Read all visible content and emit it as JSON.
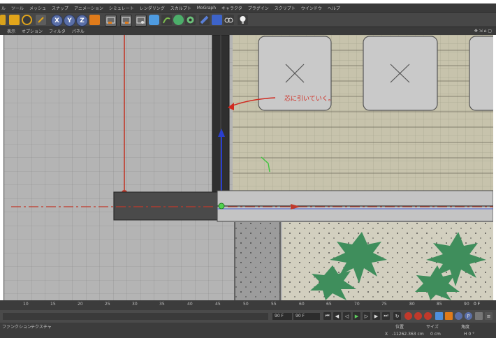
{
  "menu": {
    "items": [
      "ル",
      "ツール",
      "メッシュ",
      "スナップ",
      "アニメーション",
      "シミュレート",
      "レンダリング",
      "スカルプト",
      "MoGraph",
      "キャラクタ",
      "プラグイン",
      "スクリプト",
      "ウインドウ",
      "ヘルプ"
    ]
  },
  "toolbar": {
    "axis_x": "X",
    "axis_y": "Y",
    "axis_z": "Z",
    "icons": [
      "move-icon",
      "rotate-icon",
      "undo-icon",
      "axis-x-icon",
      "axis-y-icon",
      "axis-z-icon",
      "coordinate-icon",
      "render-view-icon",
      "render-picture-icon",
      "render-settings-icon",
      "cube-icon",
      "pen-icon",
      "nurbs-icon",
      "array-icon",
      "deformer-icon",
      "scene-icon",
      "camera-icon",
      "light-icon"
    ]
  },
  "viewport_menu": {
    "items": [
      "表示",
      "オプション",
      "フィルタ",
      "パネル"
    ]
  },
  "viewport": {
    "annotation": "芯に引いていく。",
    "annotation_color": "#d02a20"
  },
  "timeline": {
    "ticks": [
      "10",
      "15",
      "20",
      "25",
      "30",
      "35",
      "40",
      "45",
      "50",
      "55",
      "60",
      "65",
      "70",
      "75",
      "80",
      "85",
      "90"
    ],
    "frame_label": "0 F"
  },
  "playback": {
    "end_frame": "90 F",
    "max_frame": "90 F"
  },
  "bottom": {
    "left_tabs": [
      "ファンクション",
      "テクスチャ"
    ],
    "coord_headers": [
      "位置",
      "サイズ",
      "角度"
    ],
    "coord_row": [
      "X",
      "-11262.363 cm",
      "0 cm",
      "H  0 °"
    ]
  },
  "colors": {
    "accent_red": "#d02a20",
    "axis_blue": "#2a3fd0",
    "axis_green": "#3ec43e"
  }
}
